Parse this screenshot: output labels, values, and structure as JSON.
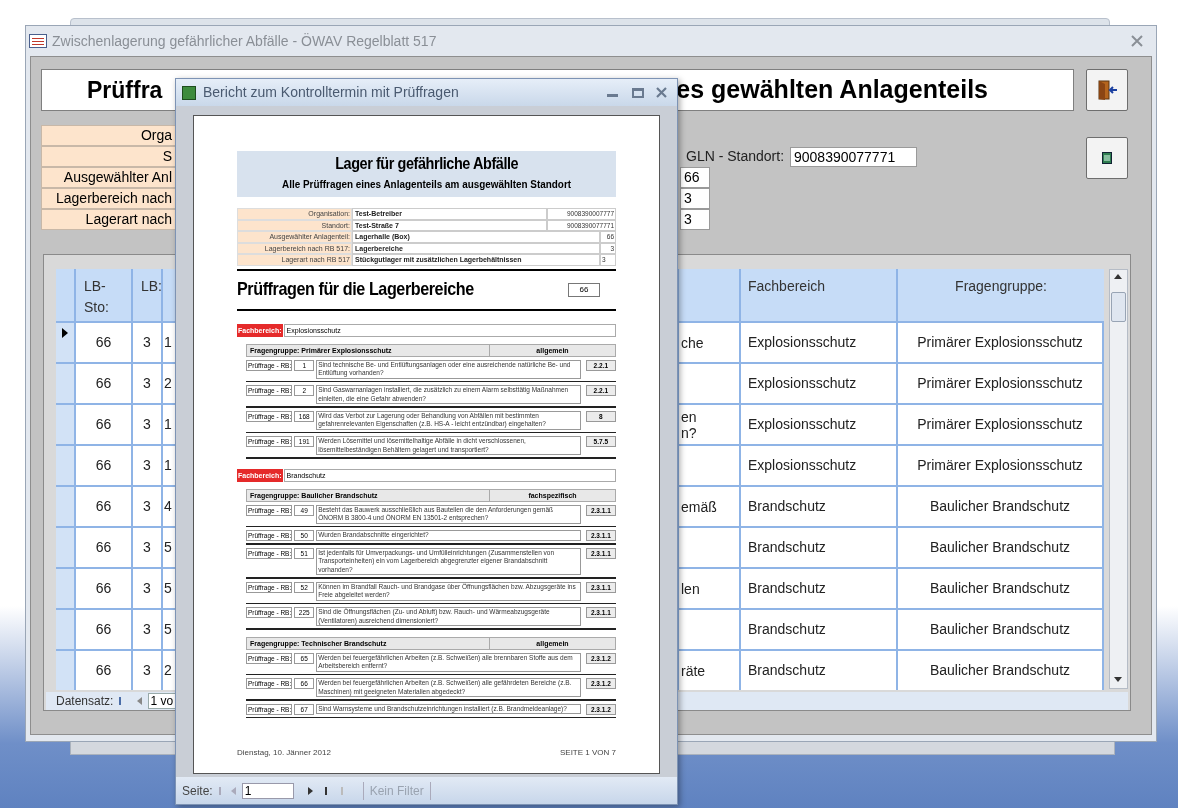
{
  "main_window": {
    "title": "Zwischenlagerung gefährlicher Abfälle - ÖWAV Regelblatt 517",
    "header_left": "Prüffra",
    "header_right": "es gewählten Anlagenteils",
    "info_labels": [
      "Orga",
      "S",
      "Ausgewählter Anl",
      "Lagerbereich nach",
      "Lagerart nach"
    ],
    "gln_label": "GLN - Standort:",
    "gln_value": "9008390077771",
    "info_values": [
      "66",
      "3",
      "3"
    ],
    "table": {
      "columns": [
        "LB-Sto:",
        "LB:",
        "Fachbereich",
        "Fragengruppe:"
      ],
      "rows": [
        {
          "selected": true,
          "lb_sto": "66",
          "lb": "3",
          "column_3": "1",
          "column_4": "che",
          "fachbereich": "Explosionsschutz",
          "fragengruppe": "Primärer Explosionsschutz"
        },
        {
          "selected": false,
          "lb_sto": "66",
          "lb": "3",
          "column_3": "2",
          "column_4": "",
          "fachbereich": "Explosionsschutz",
          "fragengruppe": "Primärer Explosionsschutz"
        },
        {
          "selected": false,
          "lb_sto": "66",
          "lb": "3",
          "column_3": "1",
          "column_4": "en\nn?",
          "fachbereich": "Explosionsschutz",
          "fragengruppe": "Primärer Explosionsschutz"
        },
        {
          "selected": false,
          "lb_sto": "66",
          "lb": "3",
          "column_3": "1",
          "column_4": "",
          "fachbereich": "Explosionsschutz",
          "fragengruppe": "Primärer Explosionsschutz"
        },
        {
          "selected": false,
          "lb_sto": "66",
          "lb": "3",
          "column_3": "4",
          "column_4": "emäß",
          "fachbereich": "Brandschutz",
          "fragengruppe": "Baulicher Brandschutz"
        },
        {
          "selected": false,
          "lb_sto": "66",
          "lb": "3",
          "column_3": "5",
          "column_4": "",
          "fachbereich": "Brandschutz",
          "fragengruppe": "Baulicher Brandschutz"
        },
        {
          "selected": false,
          "lb_sto": "66",
          "lb": "3",
          "column_3": "5",
          "column_4": "len",
          "fachbereich": "Brandschutz",
          "fragengruppe": "Baulicher Brandschutz"
        },
        {
          "selected": false,
          "lb_sto": "66",
          "lb": "3",
          "column_3": "5",
          "column_4": "",
          "fachbereich": "Brandschutz",
          "fragengruppe": "Baulicher Brandschutz"
        },
        {
          "selected": false,
          "lb_sto": "66",
          "lb": "3",
          "column_3": "2",
          "column_4": "räte",
          "fachbereich": "Brandschutz",
          "fragengruppe": "Baulicher Brandschutz"
        }
      ]
    },
    "record_nav": {
      "label": "Datensatz:",
      "value": "1 vo"
    }
  },
  "report_window": {
    "title": "Bericht zum Kontrolltermin mit Prüffragen",
    "report": {
      "title": "Lager für gefährliche Abfälle",
      "subtitle": "Alle Prüffragen eines Anlagenteils am ausgewählten Standort",
      "info": [
        {
          "label": "Organisation:",
          "value": "Test-Betreiber",
          "code": "9008390007777"
        },
        {
          "label": "Standort:",
          "value": "Test-Straße 7",
          "code": "9008390077771"
        },
        {
          "label": "Ausgewählter Anlagenteil:",
          "value": "Lagerhalle (Box)",
          "code": "66"
        },
        {
          "label": "Lagerbereich nach RB 517:",
          "value": "Lagerbereiche",
          "code": "3"
        },
        {
          "label": "Lagerart nach RB 517",
          "value": "Stückgutlager mit zusätzlichen Lagerbehältnissen",
          "code": "3"
        }
      ],
      "heading": "Prüffragen für die Lagerbereiche",
      "heading_value": "66",
      "sections": [
        {
          "label": "Fachbereich:",
          "value": "Explosionsschutz",
          "groups": [
            {
              "label": "Fragengruppe: Primärer Explosionsschutz",
              "type": "allgemein",
              "questions": [
                {
                  "label": "Prüffrage - RB:",
                  "number": "1",
                  "text": "Sind technische Be- und Entlüftungsanlagen oder eine ausreichende natürliche Be- und Entlüftung vorhanden?",
                  "ref": "2.2.1"
                },
                {
                  "label": "Prüffrage - RB:",
                  "number": "2",
                  "text": "Sind Gaswarnanlagen installiert, die zusätzlich zu einem Alarm selbsttätig Maßnahmen einleiten, die eine Gefahr abwenden?",
                  "ref": "2.2.1"
                },
                {
                  "label": "Prüffrage - RB:",
                  "number": "168",
                  "text": "Wird das Verbot zur Lagerung oder Behandlung von Abfällen mit bestimmten gefahrenrelevanten Eigenschaften (z.B. HS-A - leicht entzündbar) eingehalten?",
                  "ref": "8"
                },
                {
                  "label": "Prüffrage - RB:",
                  "number": "191",
                  "text": "Werden Lösemittel und lösemittelhaltige Abfälle in dicht verschlossenen, lösemittelbeständigen Behältern gelagert und transportiert?",
                  "ref": "5.7.5"
                }
              ]
            }
          ]
        },
        {
          "label": "Fachbereich:",
          "value": "Brandschutz",
          "groups": [
            {
              "label": "Fragengruppe: Baulicher Brandschutz",
              "type": "fachspezifisch",
              "questions": [
                {
                  "label": "Prüffrage - RB:",
                  "number": "49",
                  "text": "Besteht das Bauwerk ausschließlich aus Bauteilen die den Anforderungen gemäß ÖNORM B 3800-4 und ÖNORM EN 13501-2 entsprechen?",
                  "ref": "2.3.1.1"
                },
                {
                  "label": "Prüffrage - RB:",
                  "number": "50",
                  "text": "Wurden Brandabschnitte eingerichtet?",
                  "ref": "2.3.1.1"
                },
                {
                  "label": "Prüffrage - RB:",
                  "number": "51",
                  "text": "Ist jedenfalls für Umverpackungs- und Umfülleinrichtungen (Zusammenstellen von Transporteinheiten) ein vom Lagerbereich abgegrenzter eigener Brandabschnitt vorhanden?",
                  "ref": "2.3.1.1"
                },
                {
                  "label": "Prüffrage - RB:",
                  "number": "52",
                  "text": "Können im Brandfall Rauch- und Brandgase über Öffnungsflächen bzw. Abzugsgeräte ins Freie abgeleitet werden?",
                  "ref": "2.3.1.1"
                },
                {
                  "label": "Prüffrage - RB:",
                  "number": "225",
                  "text": "Sind die Öffnungsflächen (Zu- und Abluft) bzw. Rauch- und Wärmeabzugsgeräte (Ventilatoren) ausreichend dimensioniert?",
                  "ref": "2.3.1.1"
                }
              ]
            },
            {
              "label": "Fragengruppe: Technischer Brandschutz",
              "type": "allgemein",
              "questions": [
                {
                  "label": "Prüffrage - RB:",
                  "number": "65",
                  "text": "Werden bei feuergefährlichen Arbeiten (z.B. Schweißen) alle brennbaren Stoffe aus dem Arbeitsbereich entfernt?",
                  "ref": "2.3.1.2"
                },
                {
                  "label": "Prüffrage - RB:",
                  "number": "66",
                  "text": "Werden bei feuergefährlichen Arbeiten (z.B. Schweißen) alle gefährdeten Bereiche (z.B. Maschinen) mit geeigneten Materialien abgedeckt?",
                  "ref": "2.3.1.2"
                },
                {
                  "label": "Prüffrage - RB:",
                  "number": "67",
                  "text": "Sind Warnsysteme und Brandschutzeinrichtungen installiert (z.B. Brandmeldeanlage)?",
                  "ref": "2.3.1.2"
                }
              ]
            }
          ]
        }
      ],
      "footer_left": "Dienstag, 10. Jänner 2012",
      "footer_right": "SEITE 1 VON 7"
    },
    "nav": {
      "label": "Seite:",
      "page": "1",
      "filter": "Kein Filter"
    }
  }
}
